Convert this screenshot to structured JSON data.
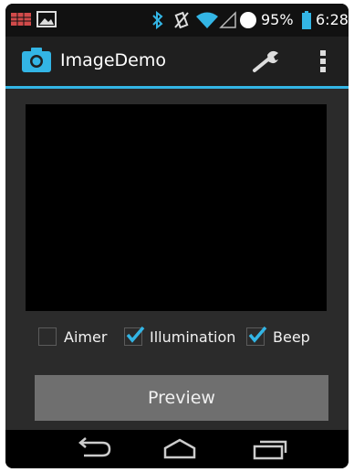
{
  "status_bar": {
    "battery_percent": "95%",
    "time": "6:28",
    "icons": [
      "notification-icon",
      "gallery-icon",
      "bluetooth-icon",
      "vibrate-off-icon",
      "wifi-icon",
      "cell-signal-icon",
      "alarm-icon",
      "battery-icon"
    ]
  },
  "action_bar": {
    "title": "ImageDemo",
    "icons": [
      "camera-icon",
      "wrench-icon",
      "overflow-menu-icon"
    ],
    "accent": "#33b5e5"
  },
  "options": [
    {
      "label": "Aimer",
      "checked": false
    },
    {
      "label": "Illumination",
      "checked": true
    },
    {
      "label": "Beep",
      "checked": true
    }
  ],
  "preview_button": {
    "label": "Preview"
  },
  "nav_bar": {
    "icons": [
      "back-icon",
      "home-icon",
      "recents-icon"
    ]
  }
}
